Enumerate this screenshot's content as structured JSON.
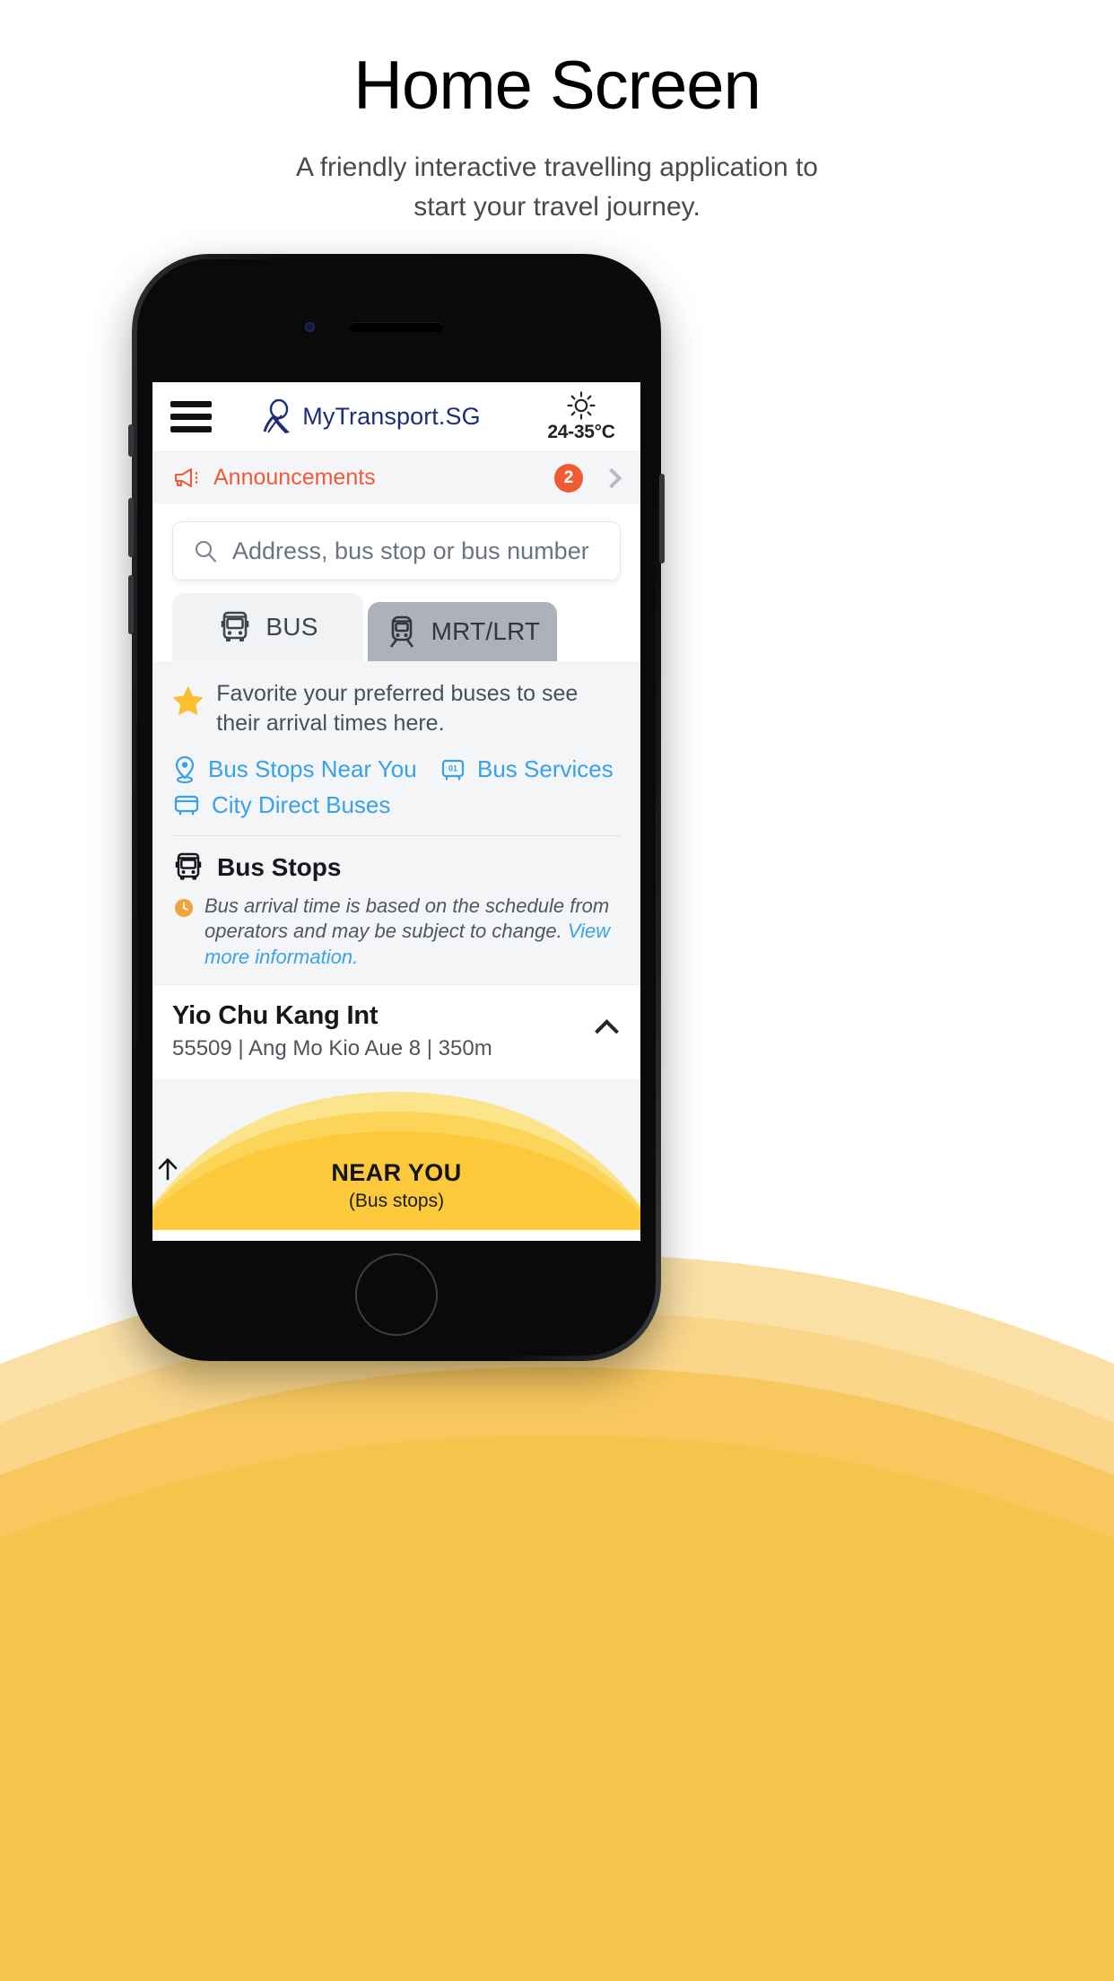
{
  "page": {
    "title": "Home Screen",
    "subtitle": "A friendly interactive travelling application to start your travel journey."
  },
  "app": {
    "header": {
      "menu_icon": "hamburger-menu-icon",
      "brand_name": "MyTransport.SG",
      "brand_logo_icon": "mytransport-ribbon-logo",
      "weather_icon": "sun-icon",
      "weather_temp": "24-35°C"
    },
    "announcements": {
      "icon": "megaphone-icon",
      "label": "Announcements",
      "count": "2",
      "chevron": "chevron-right-icon"
    },
    "search": {
      "icon": "search-icon",
      "placeholder": "Address, bus stop or bus number",
      "value": ""
    },
    "tabs": [
      {
        "id": "bus",
        "label": "BUS",
        "icon": "bus-icon",
        "active": true
      },
      {
        "id": "mrt",
        "label": "MRT/LRT",
        "icon": "train-icon",
        "active": false
      }
    ],
    "favorites": {
      "icon": "star-icon",
      "text": "Favorite your preferred buses to see their arrival times here."
    },
    "quick_links": [
      {
        "label": "Bus Stops Near You",
        "icon": "location-pin-icon"
      },
      {
        "label": "Bus Services",
        "icon": "bus-number-icon"
      },
      {
        "label": "City Direct Buses",
        "icon": "city-bus-icon"
      }
    ],
    "bus_stops_section": {
      "icon": "bus-icon",
      "title": "Bus Stops",
      "notice_icon": "clock-icon",
      "notice_text": "Bus arrival time is based on the schedule from operators and may be subject to change.",
      "notice_link": "View more information."
    },
    "stops": [
      {
        "name": "Yio Chu Kang Int",
        "meta": "55509 | Ang Mo Kio Aue 8 | 350m",
        "chevron": "chevron-up-icon"
      }
    ],
    "near_you": {
      "arrow_icon": "arrow-up-icon",
      "title": "NEAR YOU",
      "subtitle": "(Bus stops)"
    }
  },
  "colors": {
    "brand_navy": "#1d2d7a",
    "announce_orange": "#f1593a",
    "badge_orange": "#ef5c34",
    "link_blue": "#39a1e8",
    "star_yellow": "#fbc02d",
    "accent_yellow": "#fbc93a",
    "background_white": "#ffffff"
  }
}
